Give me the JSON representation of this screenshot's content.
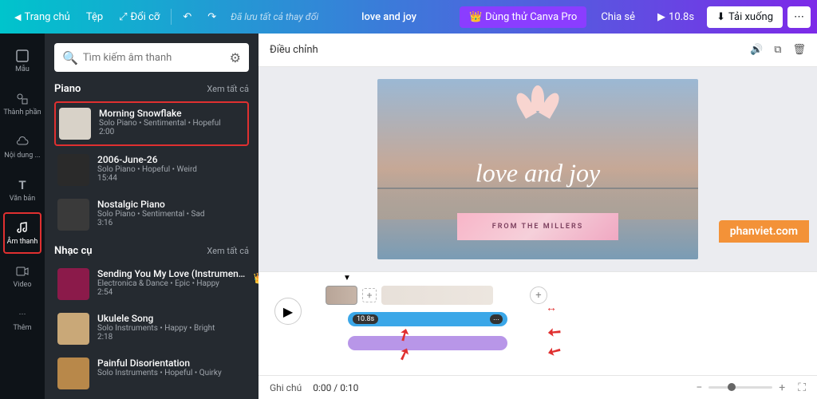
{
  "topbar": {
    "home": "Trang chủ",
    "file": "Tệp",
    "resize": "Đổi cỡ",
    "status": "Đã lưu tất cả thay đổi",
    "title": "love and joy",
    "pro": "Dùng thử Canva Pro",
    "share": "Chia sẻ",
    "duration": "10.8s",
    "download": "Tải xuống"
  },
  "rail": {
    "items": [
      {
        "label": "Mẫu",
        "icon": "template"
      },
      {
        "label": "Thành phần",
        "icon": "elements"
      },
      {
        "label": "Nội dung ...",
        "icon": "uploads"
      },
      {
        "label": "Văn bản",
        "icon": "text"
      },
      {
        "label": "Âm thanh",
        "icon": "audio",
        "active": true
      },
      {
        "label": "Video",
        "icon": "video"
      },
      {
        "label": "Thêm",
        "icon": "more"
      }
    ]
  },
  "search": {
    "placeholder": "Tìm kiếm âm thanh"
  },
  "sections": [
    {
      "title": "Piano",
      "see_all": "Xem tất cả",
      "tracks": [
        {
          "name": "Morning Snowflake",
          "meta": "Solo Piano • Sentimental • Hopeful",
          "dur": "2:00",
          "hl": true,
          "bg": "#d8d2c8"
        },
        {
          "name": "2006-June-26",
          "meta": "Solo Piano • Hopeful • Weird",
          "dur": "15:44",
          "bg": "#2a2a2a"
        },
        {
          "name": "Nostalgic Piano",
          "meta": "Solo Piano • Sentimental • Sad",
          "dur": "3:16",
          "bg": "#3a3a3a"
        }
      ]
    },
    {
      "title": "Nhạc cụ",
      "see_all": "Xem tất cả",
      "tracks": [
        {
          "name": "Sending You My Love (Instrument...",
          "meta": "Electronica & Dance • Epic • Happy",
          "dur": "2:54",
          "bg": "#8b1a4a",
          "crown": true
        },
        {
          "name": "Ukulele Song",
          "meta": "Solo Instruments • Happy • Bright",
          "dur": "2:18",
          "bg": "#c9a878"
        },
        {
          "name": "Painful Disorientation",
          "meta": "Solo Instruments • Hopeful • Quirky",
          "dur": "",
          "bg": "#b8884a"
        }
      ]
    }
  ],
  "adjust": {
    "label": "Điều chỉnh"
  },
  "preview": {
    "love_text": "love and joy",
    "subtitle": "FROM THE MILLERS"
  },
  "timeline": {
    "badge": "10.8s"
  },
  "bottom": {
    "notes": "Ghi chú",
    "time": "0:00 / 0:10"
  },
  "watermark": "phanviet.com"
}
